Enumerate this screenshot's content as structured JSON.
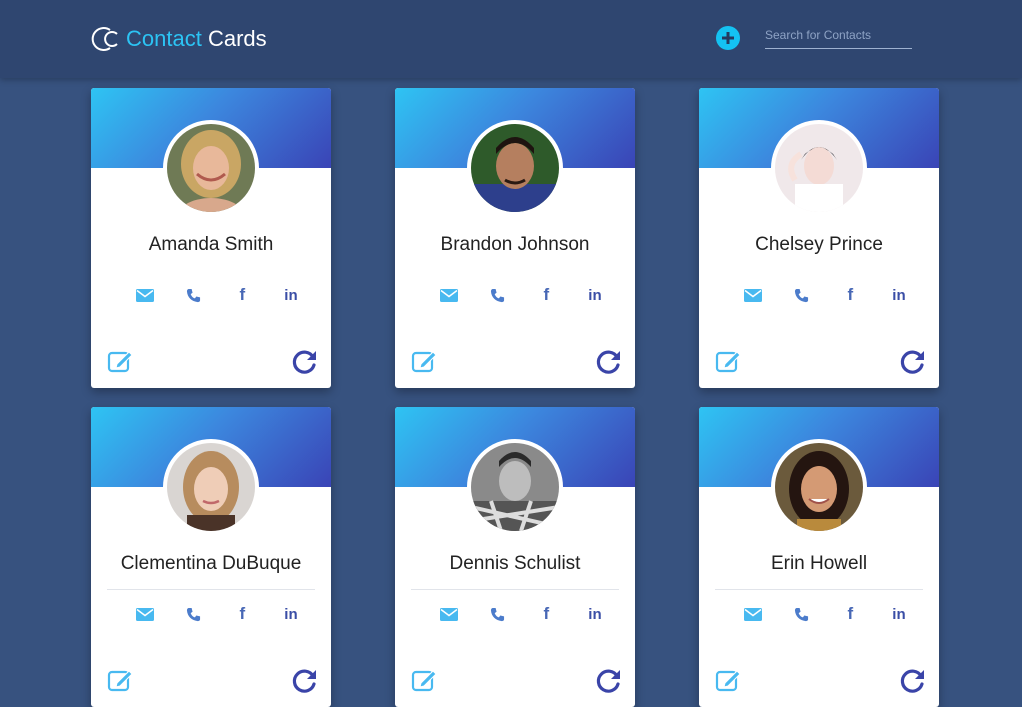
{
  "header": {
    "brand_part1": "Contact",
    "brand_part2": "Cards",
    "search_placeholder": "Search for Contacts"
  },
  "colors": {
    "background": "#37527f",
    "header_bg": "#2f4670",
    "accent_cyan": "#2cc4f4",
    "gradient_start": "#2ec4f3",
    "gradient_end": "#3a44b6",
    "email_icon": "#48b9f0",
    "phone_icon": "#4c7ccb",
    "facebook_icon": "#4767b5",
    "linkedin_icon": "#3a4ea6"
  },
  "icons": {
    "brand": "cc-logo-icon",
    "add": "plus-circle-icon",
    "email": "envelope-icon",
    "phone": "phone-icon",
    "facebook": "facebook-icon",
    "linkedin": "linkedin-icon",
    "edit": "edit-icon",
    "refresh": "refresh-icon"
  },
  "social_glyphs": {
    "facebook": "f",
    "linkedin": "in"
  },
  "contacts": [
    {
      "name": "Amanda Smith"
    },
    {
      "name": "Brandon Johnson"
    },
    {
      "name": "Chelsey Prince"
    },
    {
      "name": "Clementina DuBuque"
    },
    {
      "name": "Dennis Schulist"
    },
    {
      "name": "Erin Howell"
    }
  ]
}
